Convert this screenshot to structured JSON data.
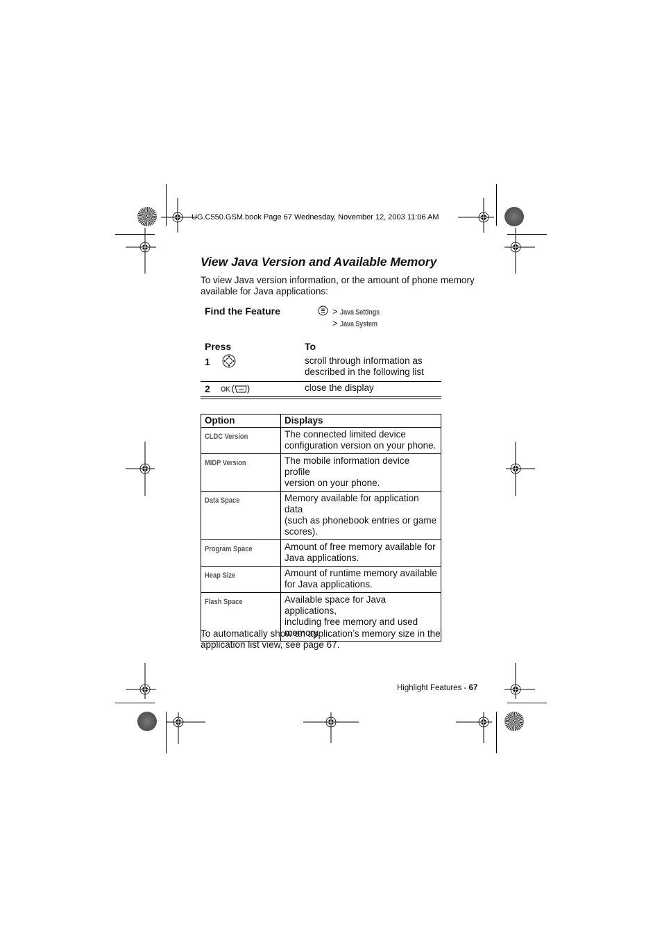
{
  "header": {
    "print_line": "UG.C550.GSM.book  Page 67  Wednesday, November 12, 2003  11:06 AM"
  },
  "section": {
    "title": "View Java Version and Available Memory",
    "intro": [
      "To view Java version information, or the amount of phone memory",
      "available for Java applications:"
    ]
  },
  "find_feature": {
    "label": "Find the Feature",
    "menu_icon": "menu-key-icon",
    "path": [
      {
        "separator": ">",
        "item": "Java Settings"
      },
      {
        "separator": ">",
        "item": "Java System"
      }
    ]
  },
  "steps": {
    "col_press": "Press",
    "col_to": "To",
    "rows": [
      {
        "num": "1",
        "key_icon": "nav-key-icon",
        "key_label": "",
        "action": [
          "scroll through information as",
          "described in the following list"
        ]
      },
      {
        "num": "2",
        "key_icon": "right-soft-key-icon",
        "key_label": "OK",
        "action": [
          "close the display"
        ]
      }
    ]
  },
  "options_table": {
    "headers": [
      "Option",
      "Displays"
    ],
    "rows": [
      {
        "option": "CLDC Version",
        "displays": [
          "The connected limited device",
          "configuration version on your phone."
        ]
      },
      {
        "option": "MIDP Version",
        "displays": [
          "The mobile information device profile",
          "version on your phone."
        ]
      },
      {
        "option": "Data Space",
        "displays": [
          "Memory available for application data",
          "(such as phonebook entries or game",
          "scores)."
        ]
      },
      {
        "option": "Program Space",
        "displays": [
          "Amount of free memory available for",
          "Java applications."
        ]
      },
      {
        "option": "Heap Size",
        "displays": [
          "Amount of runtime memory available",
          "for Java applications."
        ]
      },
      {
        "option": "Flash Space",
        "displays": [
          "Available space for Java applications,",
          "including free memory and used",
          "memory."
        ]
      }
    ]
  },
  "closing": [
    "To automatically show an application’s memory size in the",
    "application list view, see page 67."
  ],
  "footer": {
    "section": "Highlight Features - ",
    "page": "67"
  }
}
